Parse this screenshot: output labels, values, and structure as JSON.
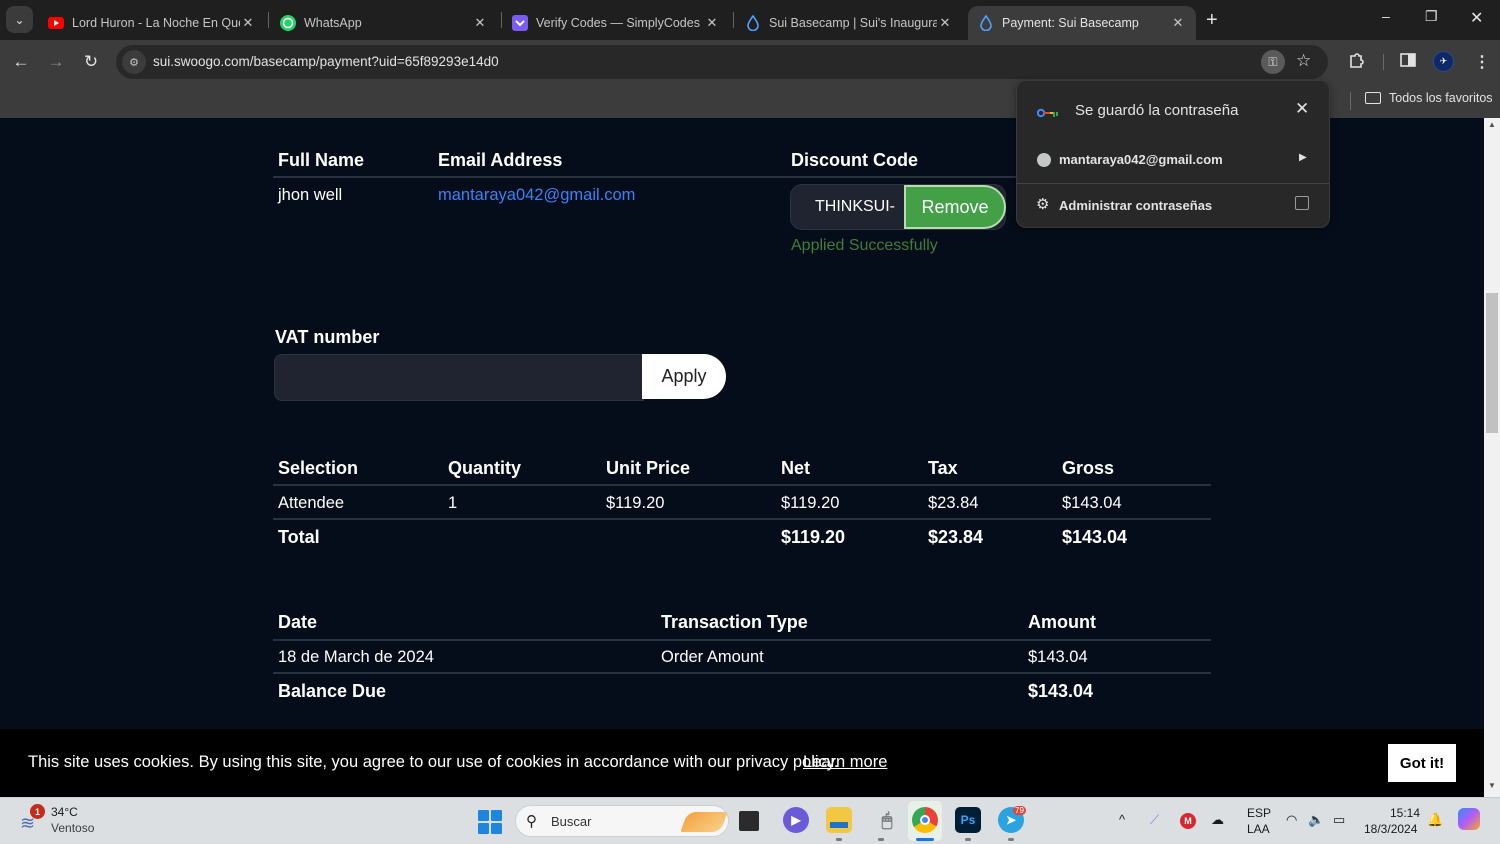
{
  "browser": {
    "tabs": [
      {
        "title": "Lord Huron - La Noche En Que",
        "icon": "youtube-icon",
        "active": false
      },
      {
        "title": "WhatsApp",
        "icon": "whatsapp-icon",
        "active": false
      },
      {
        "title": "Verify Codes — SimplyCodes",
        "icon": "simplycodes-icon",
        "active": false
      },
      {
        "title": "Sui Basecamp | Sui's Inaugural Event",
        "icon": "sui-drop-icon",
        "active": false
      },
      {
        "title": "Payment: Sui Basecamp",
        "icon": "sui-drop-icon",
        "active": true
      }
    ],
    "tab_close_glyph": "✕",
    "new_tab_glyph": "+",
    "window_controls": {
      "minimize": "–",
      "restore": "❐",
      "close": "✕"
    },
    "url": "sui.swoogo.com/basecamp/payment?uid=65f89293e14d0",
    "bookmarks_all_label": "Todos los favoritos"
  },
  "password_popup": {
    "title": "Se guardó la contraseña",
    "account": "mantaraya042@gmail.com",
    "manage_label": "Administrar contraseñas",
    "close_glyph": "✕"
  },
  "attendee": {
    "headers": {
      "full_name": "Full Name",
      "email": "Email Address",
      "discount": "Discount Code"
    },
    "full_name": "jhon well",
    "email": "mantaraya042@gmail.com",
    "discount_code": "THINKSUI-",
    "remove_label": "Remove",
    "applied_message": "Applied Successfully"
  },
  "vat": {
    "label": "VAT number",
    "value": "",
    "apply_label": "Apply"
  },
  "order_table": {
    "headers": [
      "Selection",
      "Quantity",
      "Unit Price",
      "Net",
      "Tax",
      "Gross"
    ],
    "rows": [
      {
        "selection": "Attendee",
        "quantity": "1",
        "unit_price": "$119.20",
        "net": "$119.20",
        "tax": "$23.84",
        "gross": "$143.04"
      }
    ],
    "total": {
      "label": "Total",
      "net": "$119.20",
      "tax": "$23.84",
      "gross": "$143.04"
    }
  },
  "transactions": {
    "headers": [
      "Date",
      "Transaction Type",
      "Amount"
    ],
    "rows": [
      {
        "date": "18 de March de 2024",
        "type": "Order Amount",
        "amount": "$143.04"
      }
    ],
    "balance": {
      "label": "Balance Due",
      "amount": "$143.04"
    }
  },
  "cookie_banner": {
    "text": "This site uses cookies. By using this site, you agree to our use of cookies in accordance with our privacy policy.",
    "link": "Learn more",
    "button": "Got it!"
  },
  "taskbar": {
    "weather_badge": "1",
    "temperature": "34°C",
    "weather": "Ventoso",
    "search_placeholder": "Buscar",
    "telegram_badge": "79",
    "lang_line1": "ESP",
    "lang_line2": "LAA",
    "time": "15:14",
    "date": "18/3/2024"
  },
  "colors": {
    "page_bg": "#040d19",
    "link": "#3b82f6",
    "success_green": "#43a047",
    "applied_text": "#3f7e3a"
  }
}
